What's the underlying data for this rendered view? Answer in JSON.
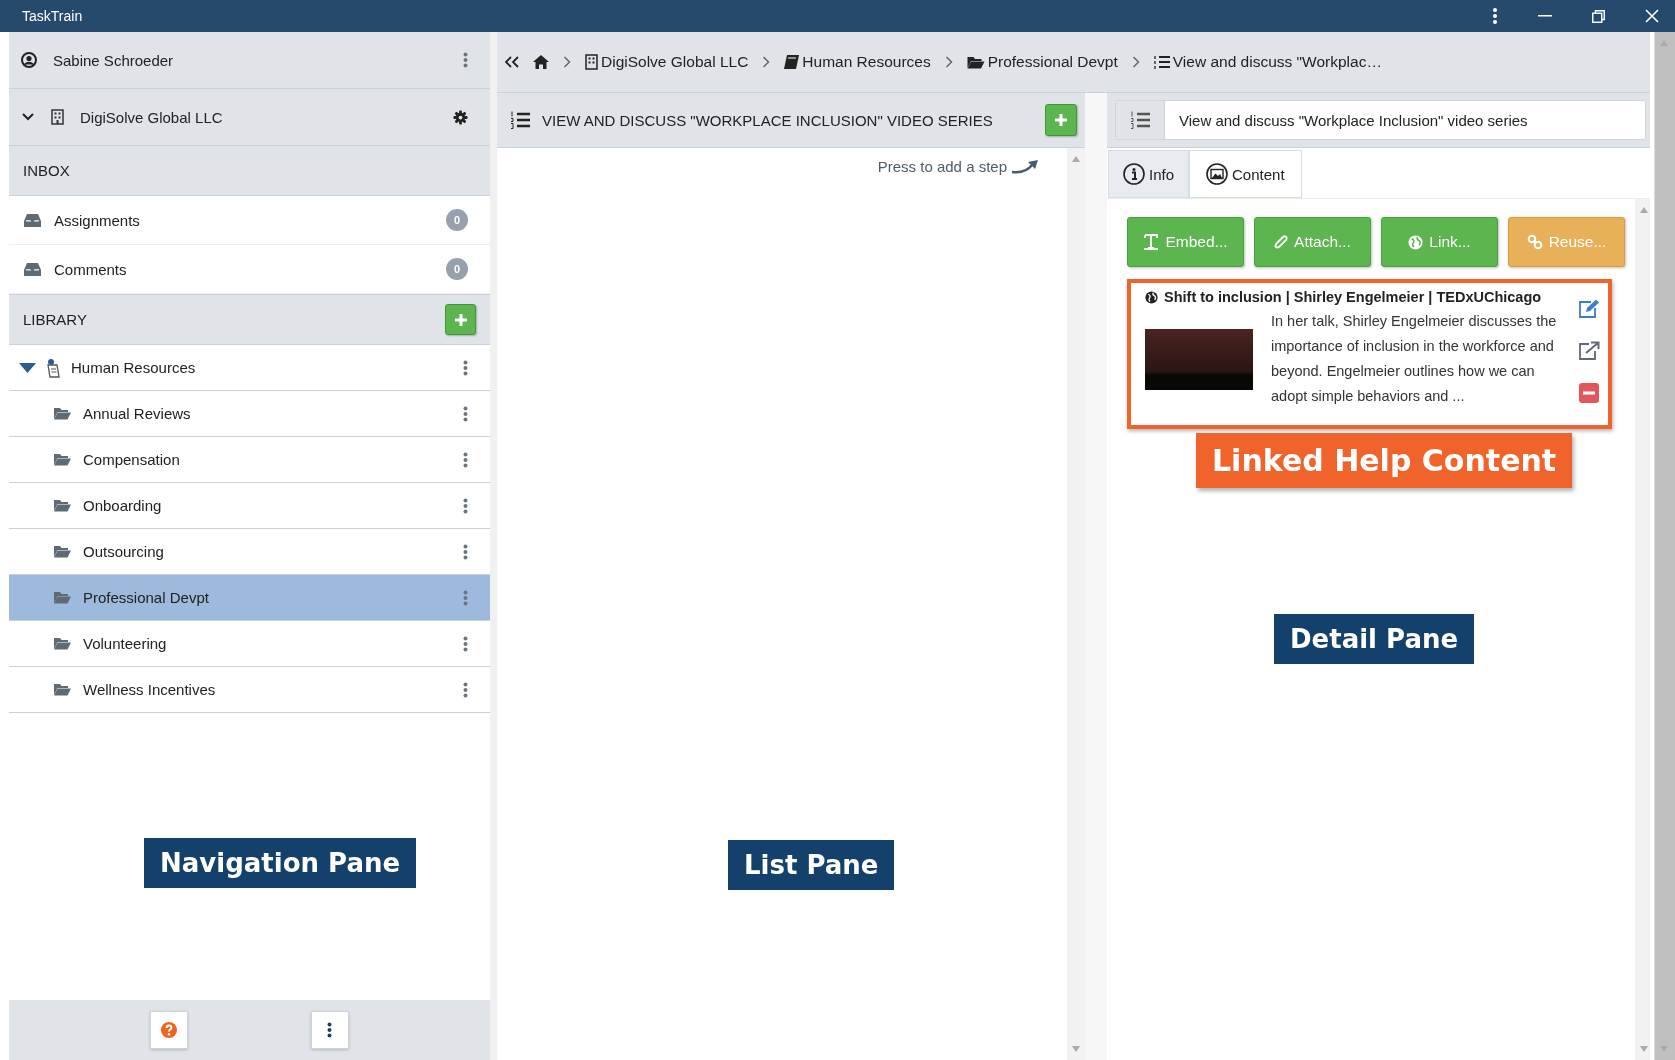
{
  "window": {
    "title": "TaskTrain"
  },
  "nav": {
    "user": {
      "name": "Sabine Schroeder"
    },
    "org": {
      "name": "DigiSolve Global LLC",
      "expanded": true
    },
    "inbox": {
      "heading": "INBOX",
      "items": [
        {
          "label": "Assignments",
          "count": "0"
        },
        {
          "label": "Comments",
          "count": "0"
        }
      ]
    },
    "library": {
      "heading": "LIBRARY",
      "tree": [
        {
          "label": "Human Resources",
          "expanded": true,
          "selected": false,
          "children": [
            {
              "label": "Annual Reviews",
              "selected": false
            },
            {
              "label": "Compensation",
              "selected": false
            },
            {
              "label": "Onboarding",
              "selected": false
            },
            {
              "label": "Outsourcing",
              "selected": false
            },
            {
              "label": "Professional Devpt",
              "selected": true
            },
            {
              "label": "Volunteering",
              "selected": false
            },
            {
              "label": "Wellness Incentives",
              "selected": false
            }
          ]
        }
      ]
    },
    "callout": "Navigation Pane"
  },
  "breadcrumb": [
    {
      "label": "DigiSolve Global LLC",
      "kind": "org"
    },
    {
      "label": "Human Resources",
      "kind": "book"
    },
    {
      "label": "Professional Devpt",
      "kind": "folder"
    },
    {
      "label": "View and discuss \"Workplac…",
      "kind": "list"
    }
  ],
  "list_pane": {
    "title": "VIEW AND DISCUSS \"WORKPLACE INCLUSION\" VIDEO SERIES",
    "hint": "Press to add a step",
    "callout": "List Pane"
  },
  "detail_pane": {
    "title_value": "View and discuss \"Workplace Inclusion\" video series",
    "tabs": [
      {
        "label": "Info",
        "kind": "info",
        "selected": false
      },
      {
        "label": "Content",
        "kind": "content",
        "selected": true
      }
    ],
    "actions": [
      {
        "label": "Embed...",
        "kind": "embed"
      },
      {
        "label": "Attach...",
        "kind": "attach"
      },
      {
        "label": "Link...",
        "kind": "link"
      },
      {
        "label": "Reuse...",
        "kind": "reuse"
      }
    ],
    "content_items": [
      {
        "title": "Shift to inclusion | Shirley Engelmeier | TEDxUChicago",
        "description": "In her talk, Shirley Engelmeier discusses the importance of inclusion in the workforce and beyond. Engelmeier outlines how we can adopt simple behaviors and ..."
      }
    ],
    "content_callout": "Linked Help Content",
    "callout": "Detail Pane"
  }
}
